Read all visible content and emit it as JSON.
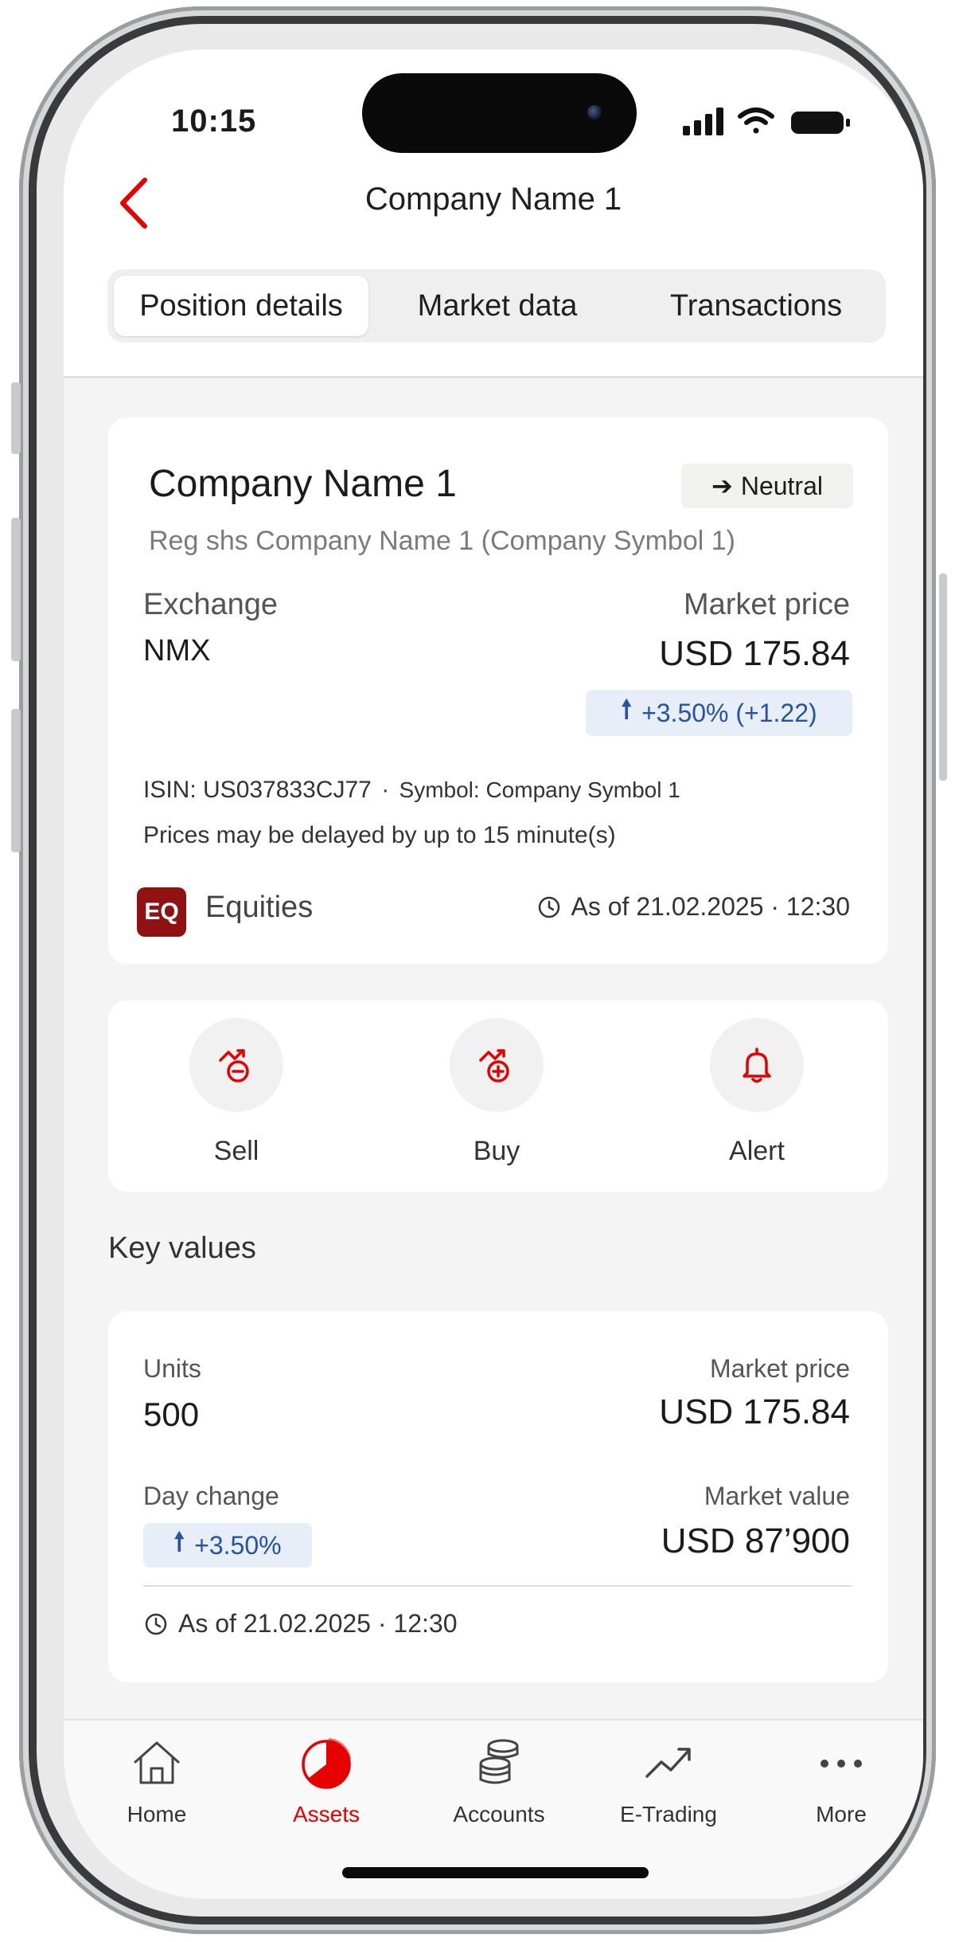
{
  "status_bar": {
    "time": "10:15"
  },
  "header": {
    "title": "Company Name 1"
  },
  "tabs": [
    {
      "label": "Position details",
      "active": true
    },
    {
      "label": "Market data",
      "active": false
    },
    {
      "label": "Transactions",
      "active": false
    }
  ],
  "position": {
    "name": "Company Name 1",
    "sentiment": "Neutral",
    "description": "Reg shs Company Name 1 (Company Symbol 1)",
    "exchange_label": "Exchange",
    "exchange_value": "NMX",
    "market_price_label": "Market price",
    "market_price_value": "USD 175.84",
    "change": "+3.50% (+1.22)",
    "isin": "ISIN: US037833CJ77",
    "separator": "·",
    "symbol": "Symbol: Company Symbol 1",
    "delay_notice": "Prices may be delayed by up to 15 minute(s)",
    "asset_class_badge": "EQ",
    "asset_class": "Equities",
    "as_of": "As of 21.02.2025 · 12:30"
  },
  "actions": [
    {
      "label": "Sell",
      "icon": "sell-icon"
    },
    {
      "label": "Buy",
      "icon": "buy-icon"
    },
    {
      "label": "Alert",
      "icon": "bell-icon"
    }
  ],
  "key_values": {
    "title": "Key values",
    "units_label": "Units",
    "units_value": "500",
    "market_price_label": "Market price",
    "market_price_value": "USD 175.84",
    "day_change_label": "Day change",
    "day_change_value": "+3.50%",
    "market_value_label": "Market value",
    "market_value_value": "USD 87’900",
    "as_of": "As of 21.02.2025 · 12:30"
  },
  "bottom_nav": [
    {
      "label": "Home",
      "icon": "home-icon",
      "active": false
    },
    {
      "label": "Assets",
      "icon": "pie-chart-icon",
      "active": true
    },
    {
      "label": "Accounts",
      "icon": "coins-icon",
      "active": false
    },
    {
      "label": "E-Trading",
      "icon": "trend-icon",
      "active": false
    },
    {
      "label": "More",
      "icon": "more-icon",
      "active": false
    }
  ],
  "colors": {
    "accent": "#e60000",
    "positive_text": "#2453a6",
    "positive_bg": "#e8eef8",
    "asset_badge": "#8f1313"
  }
}
